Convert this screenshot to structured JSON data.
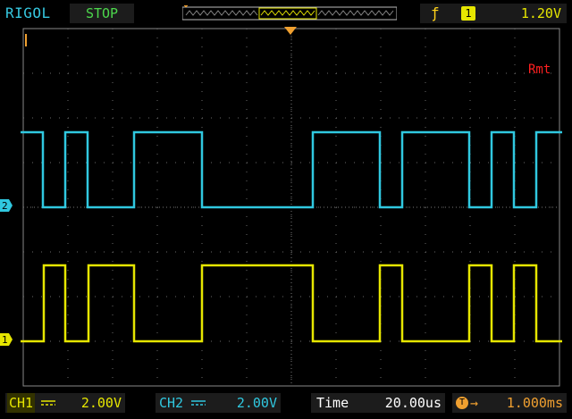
{
  "header": {
    "brand": "RIGOL",
    "run_state": "STOP",
    "trigger": {
      "edge_icon": "rising-edge-icon",
      "source": "1",
      "level": "1.20V"
    }
  },
  "screen": {
    "trigger_marker_label": "T",
    "channel2_marker_label": "2",
    "channel1_marker_label": "1",
    "mode_label": "Rmt"
  },
  "footer": {
    "ch1": {
      "name": "CH1",
      "scale": "2.00V"
    },
    "ch2": {
      "name": "CH2",
      "scale": "2.00V"
    },
    "time_label": "Time",
    "timebase": "20.00us",
    "delay_icon": "T",
    "delay_value": "1.000ms"
  },
  "colors": {
    "ch1": "#e6e600",
    "ch2": "#30c8e0",
    "trigger_marker": "#f0a030",
    "grid": "#6a6a6a",
    "rmt": "#ff2020"
  }
}
